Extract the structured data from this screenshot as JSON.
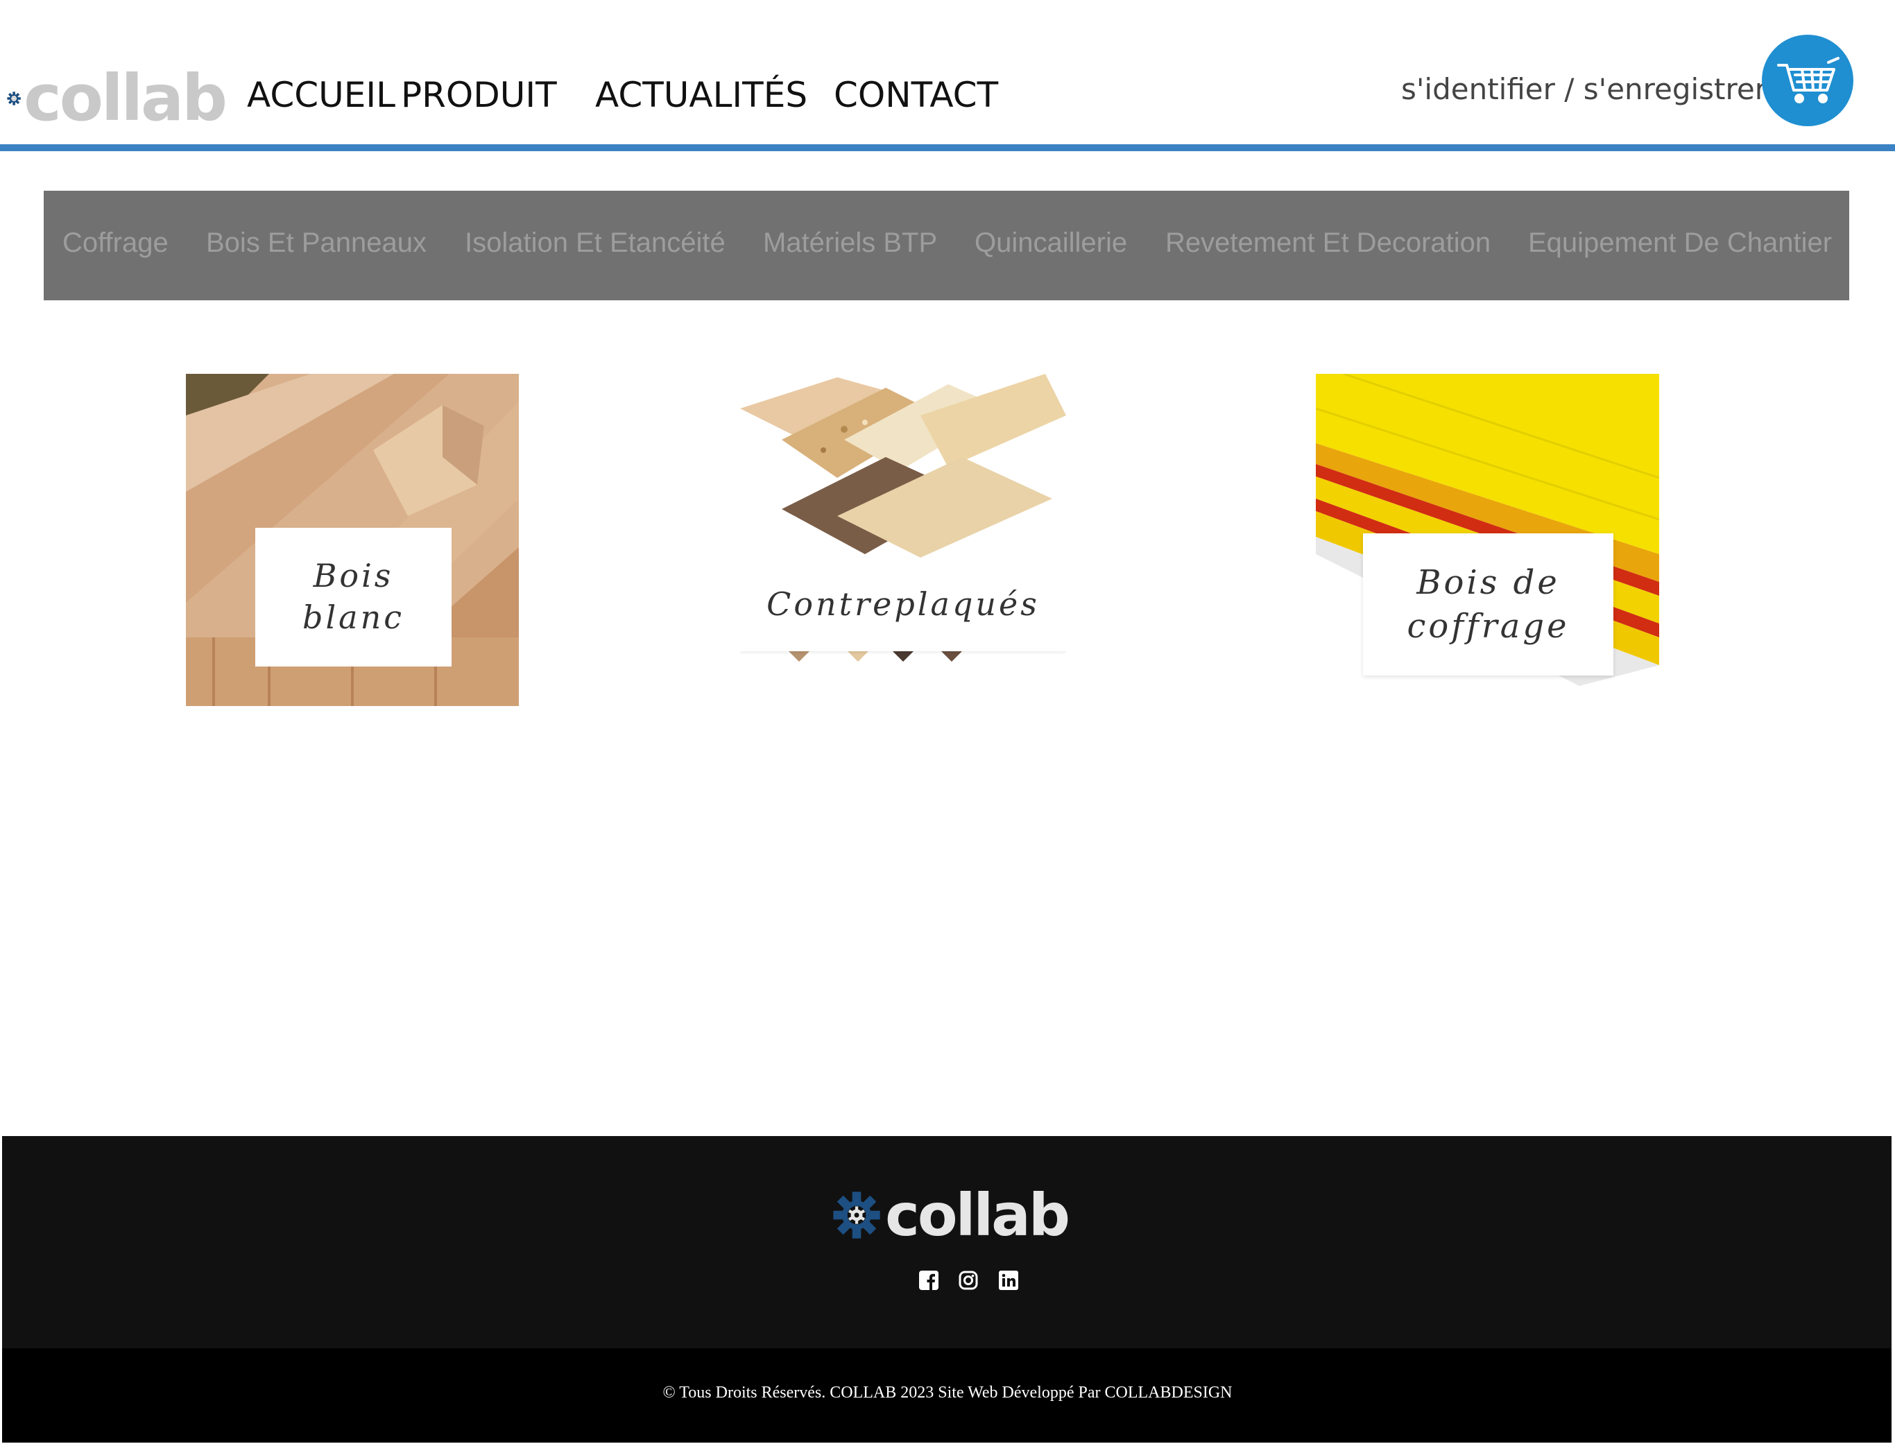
{
  "header": {
    "logo_text": "collab",
    "nav": [
      "ACCUEIL",
      "PRODUIT",
      "ACTUALITÉS",
      "CONTACT"
    ],
    "auth_link": "s'identifier / s'enregistrer",
    "cart_icon": "shopping-cart-icon"
  },
  "categories": [
    "Coffrage",
    "Bois Et Panneaux",
    "Isolation Et Etancéité",
    "Matériels BTP",
    "Quincaillerie",
    "Revetement Et Decoration",
    "Equipement De Chantier"
  ],
  "products": [
    {
      "label": "Bois blanc",
      "line1": "Bois",
      "line2": "blanc"
    },
    {
      "label": "Contreplaqués"
    },
    {
      "label": "Bois de coffrage",
      "line1": "Bois de",
      "line2": "coffrage"
    }
  ],
  "footer": {
    "logo_text": "collab",
    "social_icons": [
      "facebook-icon",
      "instagram-icon",
      "linkedin-icon"
    ],
    "copyright": "© Tous Droits Réservés. COLLAB 2023 Site Web Développé Par COLLABDESIGN"
  },
  "colors": {
    "accent_blue": "#3b82c4",
    "cart_blue": "#1f8fd1",
    "gear_blue": "#1d4f82",
    "category_bar": "#717171",
    "footer_top": "#111111",
    "footer_bottom": "#000000"
  }
}
